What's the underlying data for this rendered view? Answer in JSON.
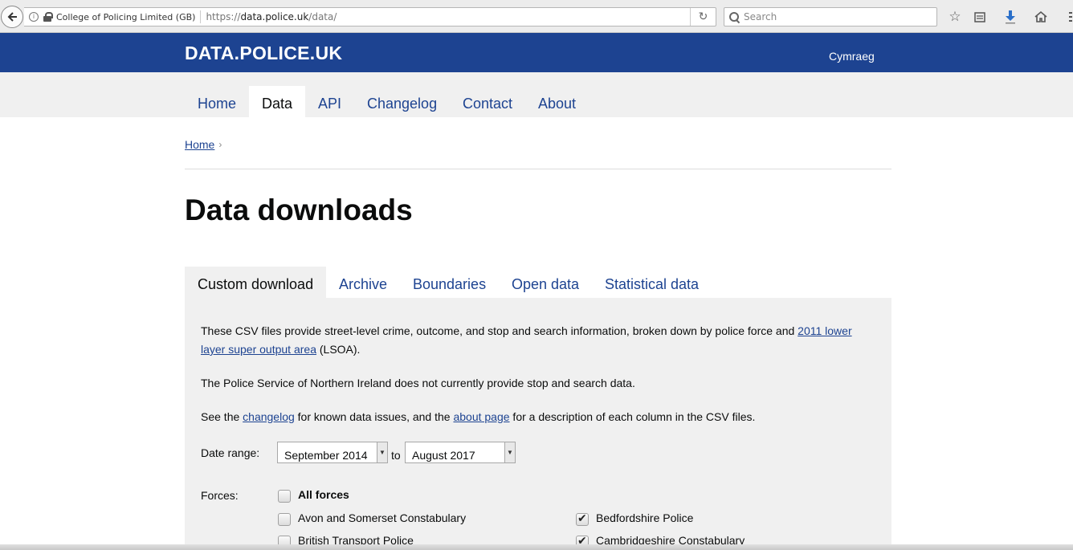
{
  "browser": {
    "org": "College of Policing Limited (GB)",
    "url_prefix": "https://",
    "url_host": "data.police.uk",
    "url_path": "/data/",
    "search_placeholder": "Search"
  },
  "header": {
    "logo": "DATA.POLICE.UK",
    "language_link": "Cymraeg",
    "brand_color": "#1d4391"
  },
  "nav": {
    "items": [
      {
        "label": "Home"
      },
      {
        "label": "Data"
      },
      {
        "label": "API"
      },
      {
        "label": "Changelog"
      },
      {
        "label": "Contact"
      },
      {
        "label": "About"
      }
    ],
    "active": "Data"
  },
  "breadcrumb": {
    "home": "Home"
  },
  "page": {
    "title": "Data downloads"
  },
  "tabs": {
    "items": [
      {
        "label": "Custom download"
      },
      {
        "label": "Archive"
      },
      {
        "label": "Boundaries"
      },
      {
        "label": "Open data"
      },
      {
        "label": "Statistical data"
      }
    ],
    "active": "Custom download"
  },
  "content": {
    "para1_a": "These CSV files provide street-level crime, outcome, and stop and search information, broken down by police force and ",
    "para1_link": "2011 lower layer super output area",
    "para1_b": " (LSOA).",
    "para2": "The Police Service of Northern Ireland does not currently provide stop and search data.",
    "para3_a": "See the ",
    "para3_link1": "changelog",
    "para3_b": " for known data issues, and the ",
    "para3_link2": "about page",
    "para3_c": " for a description of each column in the CSV files."
  },
  "form": {
    "date_range_label": "Date range:",
    "from_value": "September 2014",
    "to_label": "to",
    "to_value": "August 2017",
    "forces_label": "Forces:",
    "all_forces": "All forces",
    "forces": [
      {
        "name": "Avon and Somerset Constabulary",
        "checked": false
      },
      {
        "name": "Bedfordshire Police",
        "checked": true
      },
      {
        "name": "British Transport Police",
        "checked": false
      },
      {
        "name": "Cambridgeshire Constabulary",
        "checked": true
      }
    ]
  }
}
